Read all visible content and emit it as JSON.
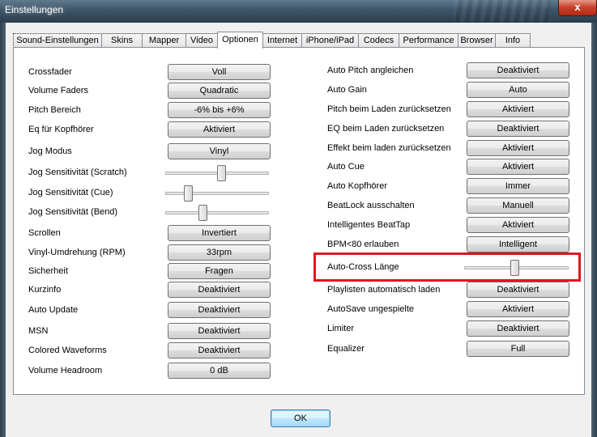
{
  "window": {
    "title": "Einstellungen",
    "close_glyph": "x",
    "icons": {
      "close": "close-icon"
    }
  },
  "tabs": [
    {
      "label": "Sound-Einstellungen",
      "active": false
    },
    {
      "label": "Skins",
      "active": false
    },
    {
      "label": "Mapper",
      "active": false
    },
    {
      "label": "Video",
      "active": false
    },
    {
      "label": "Optionen",
      "active": true
    },
    {
      "label": "Internet",
      "active": false
    },
    {
      "label": "iPhone/iPad",
      "active": false
    },
    {
      "label": "Codecs",
      "active": false
    },
    {
      "label": "Performance",
      "active": false
    },
    {
      "label": "Browser",
      "active": false
    },
    {
      "label": "Info",
      "active": false
    }
  ],
  "left": [
    {
      "label": "Crossfader",
      "value": "Voll"
    },
    {
      "label": "Volume Faders",
      "value": "Quadratic"
    },
    {
      "label": "Pitch Bereich",
      "value": "-6% bis +6%"
    },
    {
      "label": "Eq für Kopfhörer",
      "value": "Aktiviert"
    },
    {
      "label": "Jog Modus",
      "value": "Vinyl"
    },
    {
      "label": "Jog Sensitivität (Scratch)",
      "slider": 0.55
    },
    {
      "label": "Jog Sensitivität (Cue)",
      "slider": 0.2
    },
    {
      "label": "Jog Sensitivität (Bend)",
      "slider": 0.35
    },
    {
      "label": "Scrollen",
      "value": "Invertiert"
    },
    {
      "label": "Vinyl-Umdrehung (RPM)",
      "value": "33rpm"
    },
    {
      "label": "Sicherheit",
      "value": "Fragen"
    },
    {
      "label": "Kurzinfo",
      "value": "Deaktiviert"
    },
    {
      "label": "Auto Update",
      "value": "Deaktiviert"
    },
    {
      "label": "MSN",
      "value": "Deaktiviert"
    },
    {
      "label": "Colored Waveforms",
      "value": "Deaktiviert"
    },
    {
      "label": "Volume Headroom",
      "value": "0 dB"
    }
  ],
  "right": [
    {
      "label": "Auto Pitch angleichen",
      "value": "Deaktiviert"
    },
    {
      "label": "Auto Gain",
      "value": "Auto"
    },
    {
      "label": "Pitch beim Laden zurücksetzen",
      "value": "Aktiviert"
    },
    {
      "label": "EQ beim Laden zurücksetzen",
      "value": "Deaktiviert"
    },
    {
      "label": "Effekt beim laden zurücksetzen",
      "value": "Aktiviert"
    },
    {
      "label": "Auto Cue",
      "value": "Aktiviert"
    },
    {
      "label": "Auto Kopfhörer",
      "value": "Immer"
    },
    {
      "label": "BeatLock ausschalten",
      "value": "Manuell"
    },
    {
      "label": "Intelligentes BeatTap",
      "value": "Aktiviert"
    },
    {
      "label": "BPM<80 erlauben",
      "value": "Intelligent"
    },
    {
      "label": "Auto-Cross Länge",
      "slider": 0.48
    },
    {
      "label": "Playlisten automatisch laden",
      "value": "Deaktiviert"
    },
    {
      "label": "AutoSave ungespielte",
      "value": "Aktiviert"
    },
    {
      "label": "Limiter",
      "value": "Deaktiviert"
    },
    {
      "label": "Equalizer",
      "value": "Full"
    }
  ],
  "ok_label": "OK",
  "colors": {
    "highlight": "#e0141e",
    "ok_border": "#3c7fb1"
  }
}
